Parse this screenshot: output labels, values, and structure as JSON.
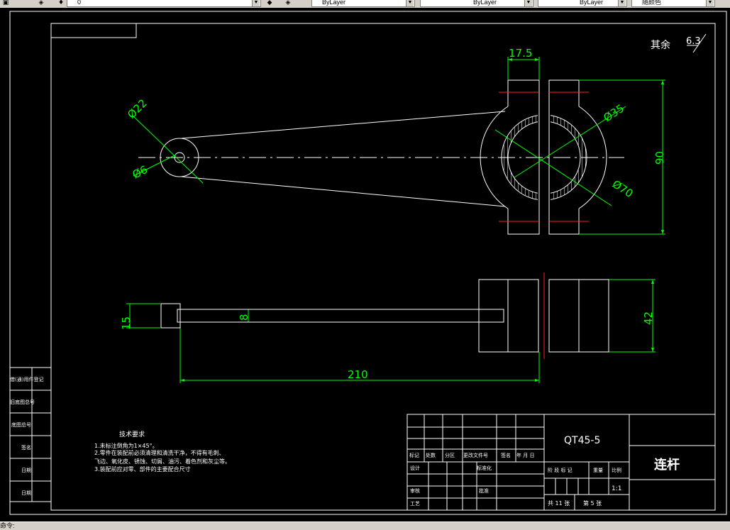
{
  "toolbar": {
    "layer_value": "0",
    "color_value": "ByLayer",
    "linetype_value": "ByLayer",
    "lineweight_value": "ByLayer",
    "plotstyle_value": "随颜色"
  },
  "drawing": {
    "roughness_note": "其余",
    "roughness_value": "6.3",
    "dims": {
      "width_top": "17.5",
      "dia_22": "Ø22",
      "dia_6": "Ø6",
      "dia_35": "Ø35",
      "dia_70": "Ø70",
      "height_90": "90",
      "height_15": "15",
      "thick_8": "8",
      "height_42": "42",
      "length_210": "210"
    },
    "tech_requirements": {
      "title": "技术要求",
      "lines": [
        "1.未标注倒角为1×45°。",
        "2.零件在装配前必须清理和清洗干净，不得有毛刺、",
        "飞边、氧化皮、锈蚀、切屑、油污、着色剂和灰尘等。",
        "3.装配前应对零、部件的主要配合尺寸"
      ]
    },
    "left_side_labels": [
      "借(通)用件登记",
      "旧底图总号",
      "底图总号",
      "签名",
      "日期",
      "日期"
    ],
    "title_block": {
      "material": "QT45-5",
      "part_name": "连杆",
      "scale": "1:1",
      "row_labels": [
        "标记",
        "处数",
        "分区",
        "更改文件号",
        "签名",
        "年 月 日"
      ],
      "design": "设计",
      "standardize": "标准化",
      "review": "审核",
      "process": "工艺",
      "approve": "批准",
      "stage_header": "阶 段 标 记",
      "weight_header": "重量",
      "scale_header": "比例",
      "sheets_total": "共 11 张",
      "sheet_no": "第 5 张"
    }
  },
  "status": {
    "command_text": "命令:"
  }
}
